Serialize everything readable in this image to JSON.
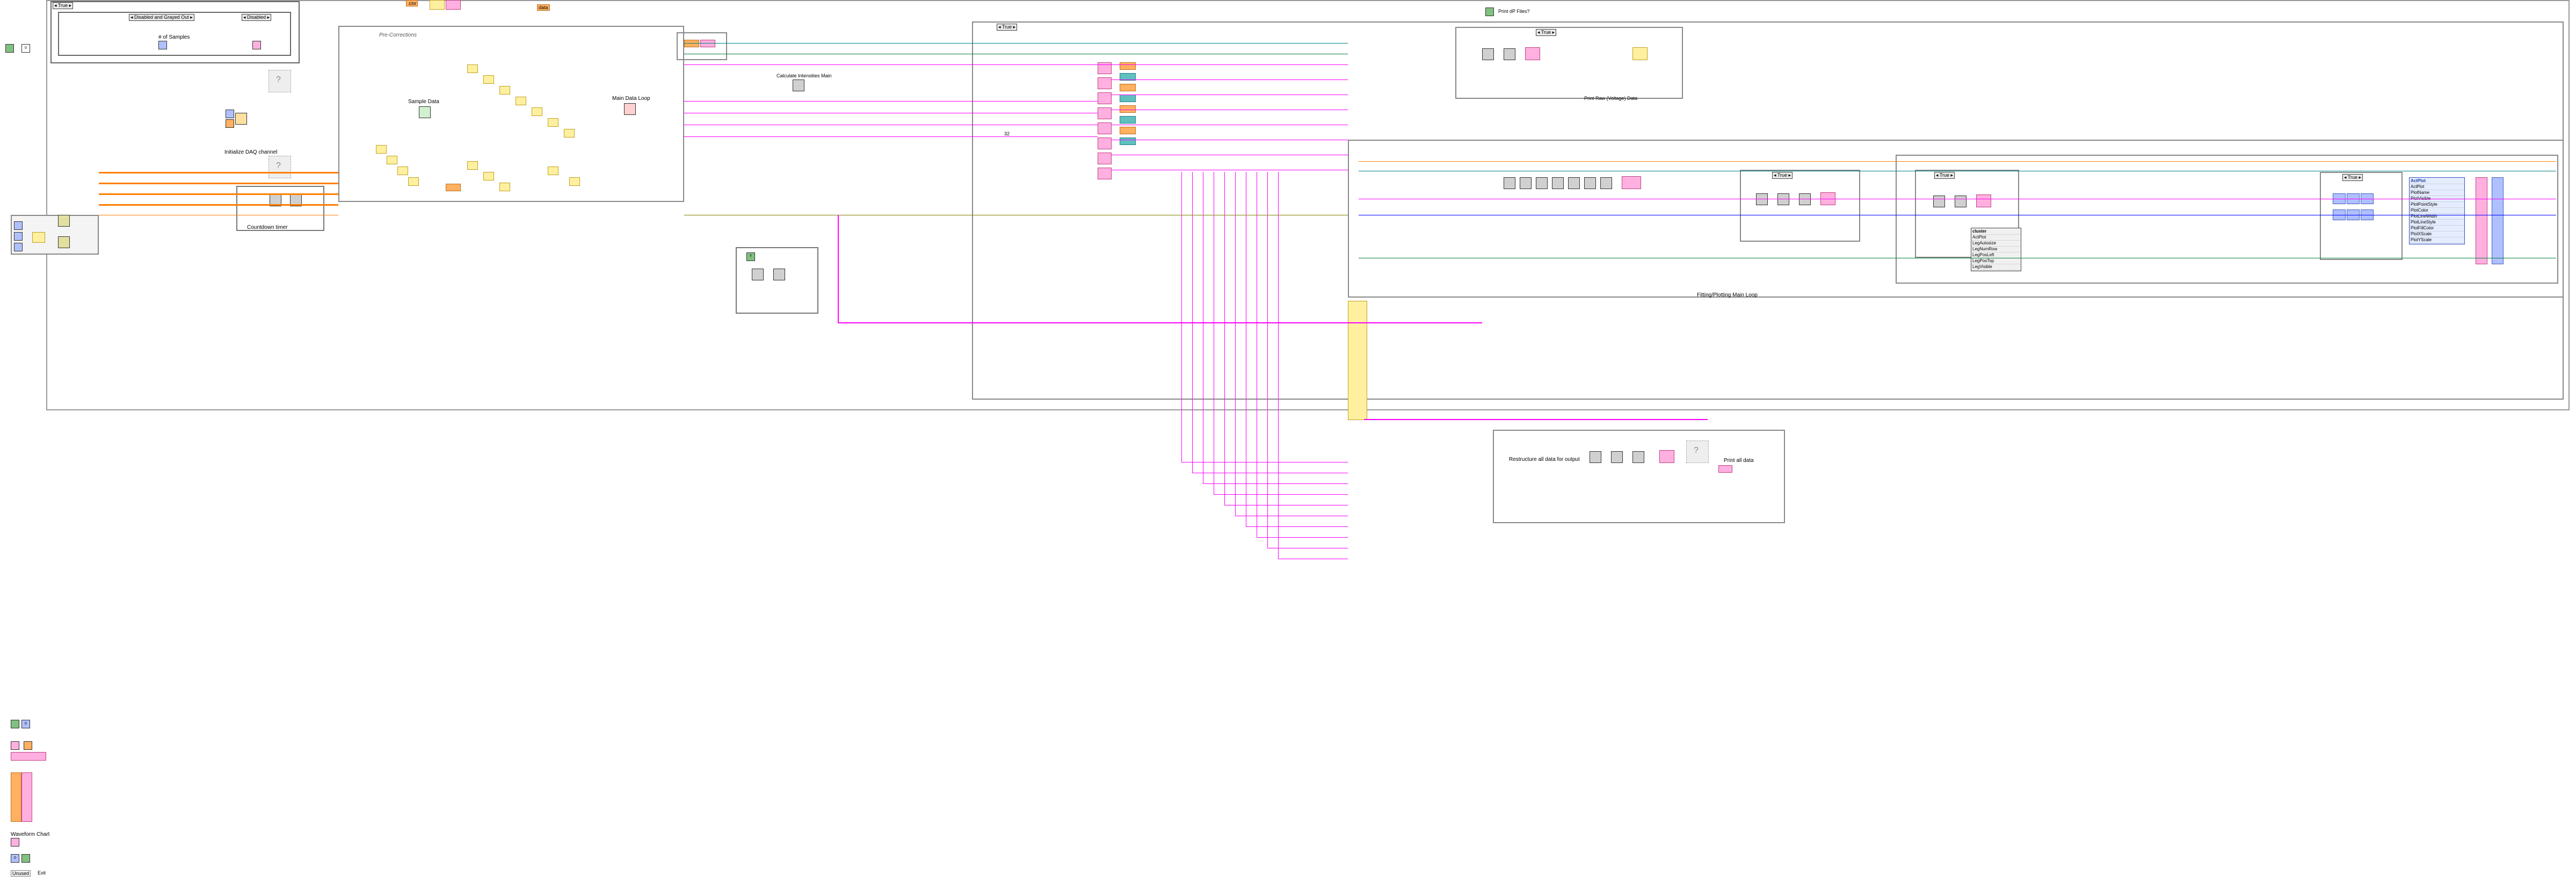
{
  "app": "LabVIEW Block Diagram",
  "outer_case": {
    "selector_label": "True"
  },
  "disabled_case": {
    "selector_label": "Disabled and Grayed Out",
    "right_selector": "Disabled",
    "sample_label": "# of Samples"
  },
  "sample_data_lbl": "Sample Data",
  "main_loop_label": "Main Data Loop",
  "init_daq_lbl": "Initialize DAQ channel",
  "countdown_lbl": "Countdown timer",
  "fitting_loop_lbl": "Fitting/Plotting Main Loop",
  "restructure_lbl": "Restructure all data for output",
  "print_all_lbl": "Print all data",
  "print_raw_lbl": "Print Raw (Voltage) Data",
  "print_dp_files_lbl": "Print dP Files?",
  "corrections_lbl": "Pre-Corrections",
  "calc_inten_lbl": "Calculate Intensities Main",
  "cluster_group": {
    "title": "cluster",
    "items": [
      "ActPlot",
      "LegAutosize",
      "LegNumRow",
      "LegPosLeft",
      "LegPosTop",
      "LegVisible"
    ]
  },
  "prop_node": {
    "title": "ActPlot",
    "items": [
      "ActPlot",
      "PlotName",
      "PlotVisible",
      "PlotPointStyle",
      "PlotColor",
      "PlotLineWidth",
      "PlotLineStyle",
      "PlotFillColor",
      "PlotXScale",
      "PlotYScale"
    ]
  },
  "true_box1": "True",
  "true_box2": "True",
  "true_box3": "True",
  "true_box4": "True",
  "true_box5": "True",
  "n32": "32",
  "tf_true": "T",
  "tf_false": "F",
  "csv_label": ".csv",
  "data_label": "data",
  "enum_unused": "Unused",
  "btm_labels": {
    "a": "0",
    "b": "0",
    "c": "Waveform Chart",
    "d": "0",
    "e": "Exit"
  }
}
